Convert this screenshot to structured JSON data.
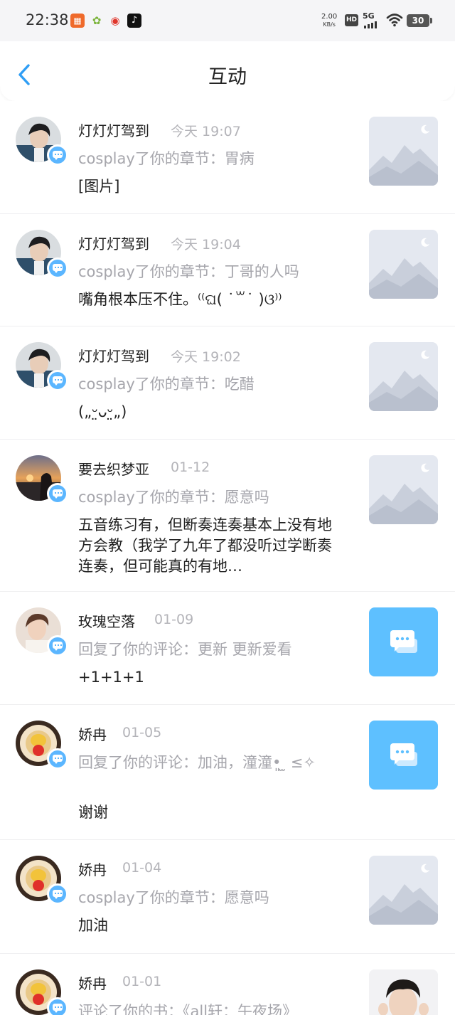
{
  "status_bar": {
    "time": "22:38",
    "net_speed_value": "2.00",
    "net_speed_unit": "KB/s",
    "hd": "HD",
    "network": "5G",
    "battery": "30"
  },
  "header": {
    "title": "互动"
  },
  "items": [
    {
      "name": "灯灯灯驾到",
      "date": "今天 19:07",
      "action": "cosplay了你的章节：胃病",
      "content": "[图片]",
      "thumb": "placeholder"
    },
    {
      "name": "灯灯灯驾到",
      "date": "今天 19:04",
      "action": "cosplay了你的章节：丁哥的人吗",
      "content": "嘴角根本压不住。⁽⁽ଘ( ˙꒳˙ )ଓ⁾⁾",
      "thumb": "placeholder"
    },
    {
      "name": "灯灯灯驾到",
      "date": "今天 19:02",
      "action": "cosplay了你的章节：吃醋",
      "content": "(„ᵕ̤ᴗᵕ̤„)",
      "thumb": "placeholder"
    },
    {
      "name": "要去织梦亚",
      "date": "01-12",
      "action": "cosplay了你的章节：愿意吗",
      "content": "五音练习有，但断奏连奏基本上没有地方会教（我学了九年了都没听过学断奏连奏，但可能真的有地…",
      "thumb": "placeholder"
    },
    {
      "name": "玫瑰空落",
      "date": "01-09",
      "action": "回复了你的评论：更新 更新爱看",
      "content": "+1+1+1",
      "thumb": "chat"
    },
    {
      "name": "娇冉",
      "date": "01-05",
      "action": "回复了你的评论：加油，潼潼•͈ ̫ ≤✧",
      "content": "谢谢",
      "thumb": "chat"
    },
    {
      "name": "娇冉",
      "date": "01-04",
      "action": "cosplay了你的章节：愿意吗",
      "content": "加油",
      "thumb": "placeholder"
    },
    {
      "name": "娇冉",
      "date": "01-01",
      "action": "评论了你的书：《all轩：午夜场》",
      "content": "",
      "thumb": "photo"
    }
  ],
  "colors": {
    "accent": "#2f9ef5",
    "badge": "#5bb6ff",
    "chat_thumb": "#5ec0ff",
    "muted_text": "#a6a6ac"
  },
  "icons": {
    "back": "chevron-left-icon",
    "badge": "comment-icon",
    "chat_thumb": "message-bubble-icon",
    "placeholder": "image-placeholder-icon"
  }
}
